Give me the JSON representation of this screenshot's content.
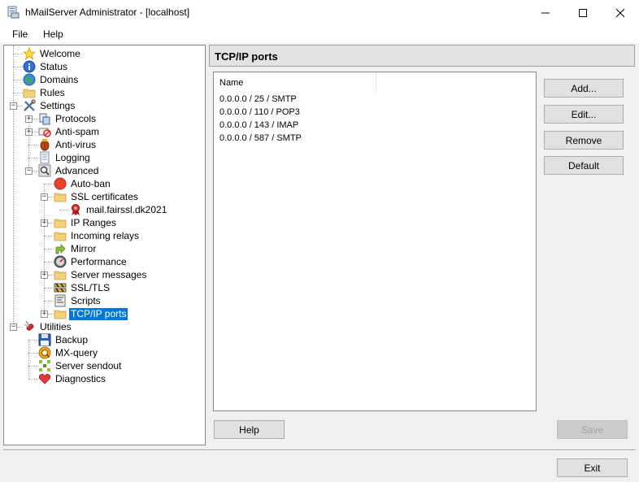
{
  "window": {
    "title": "hMailServer Administrator - [localhost]"
  },
  "menu": {
    "items": [
      {
        "label": "File"
      },
      {
        "label": "Help"
      }
    ]
  },
  "tree": {
    "items": [
      {
        "id": "welcome",
        "label": "Welcome",
        "icon": "star-icon",
        "depth": 1
      },
      {
        "id": "status",
        "label": "Status",
        "icon": "info-icon",
        "depth": 1
      },
      {
        "id": "domains",
        "label": "Domains",
        "icon": "globe-icon",
        "depth": 1
      },
      {
        "id": "rules",
        "label": "Rules",
        "icon": "folder-icon",
        "depth": 1
      },
      {
        "id": "settings",
        "label": "Settings",
        "icon": "tools-icon",
        "depth": 1,
        "expander": "-"
      },
      {
        "id": "protocols",
        "label": "Protocols",
        "icon": "protocols-icon",
        "depth": 2,
        "expander": "+"
      },
      {
        "id": "anti-spam",
        "label": "Anti-spam",
        "icon": "anti-spam-icon",
        "depth": 2,
        "expander": "+"
      },
      {
        "id": "anti-virus",
        "label": "Anti-virus",
        "icon": "bug-icon",
        "depth": 2
      },
      {
        "id": "logging",
        "label": "Logging",
        "icon": "document-icon",
        "depth": 2
      },
      {
        "id": "advanced",
        "label": "Advanced",
        "icon": "magnifier-icon",
        "depth": 2,
        "expander": "-"
      },
      {
        "id": "auto-ban",
        "label": "Auto-ban",
        "icon": "stop-icon",
        "depth": 3
      },
      {
        "id": "ssl-certificates",
        "label": "SSL certificates",
        "icon": "folder-icon",
        "depth": 3,
        "expander": "-"
      },
      {
        "id": "cert-mail",
        "label": "mail.fairssl.dk2021",
        "icon": "certificate-icon",
        "depth": 4
      },
      {
        "id": "ip-ranges",
        "label": "IP Ranges",
        "icon": "folder-icon",
        "depth": 3,
        "expander": "+"
      },
      {
        "id": "incoming-relays",
        "label": "Incoming relays",
        "icon": "folder-icon",
        "depth": 3
      },
      {
        "id": "mirror",
        "label": "Mirror",
        "icon": "mirror-arrow-icon",
        "depth": 3
      },
      {
        "id": "performance",
        "label": "Performance",
        "icon": "gauge-icon",
        "depth": 3
      },
      {
        "id": "server-messages",
        "label": "Server messages",
        "icon": "folder-icon",
        "depth": 3,
        "expander": "+"
      },
      {
        "id": "ssl-tls",
        "label": "SSL/TLS",
        "icon": "barrier-icon",
        "depth": 3
      },
      {
        "id": "scripts",
        "label": "Scripts",
        "icon": "script-icon",
        "depth": 3
      },
      {
        "id": "tcpip-ports",
        "label": "TCP/IP ports",
        "icon": "folder-icon",
        "depth": 3,
        "expander": "+",
        "selected": true
      },
      {
        "id": "utilities",
        "label": "Utilities",
        "icon": "swiss-knife-icon",
        "depth": 1,
        "expander": "-"
      },
      {
        "id": "backup",
        "label": "Backup",
        "icon": "floppy-icon",
        "depth": 2
      },
      {
        "id": "mx-query",
        "label": "MX-query",
        "icon": "mx-query-icon",
        "depth": 2
      },
      {
        "id": "server-sendout",
        "label": "Server sendout",
        "icon": "sendout-icon",
        "depth": 2
      },
      {
        "id": "diagnostics",
        "label": "Diagnostics",
        "icon": "heart-icon",
        "depth": 2
      }
    ]
  },
  "panel": {
    "title": "TCP/IP ports",
    "list": {
      "column": "Name",
      "rows": [
        "0.0.0.0 / 25 / SMTP",
        "0.0.0.0 / 110 / POP3",
        "0.0.0.0 / 143 / IMAP",
        "0.0.0.0 / 587 / SMTP"
      ]
    },
    "buttons": {
      "add": "Add...",
      "edit": "Edit...",
      "remove": "Remove",
      "default": "Default",
      "help": "Help",
      "save": "Save"
    }
  },
  "footer": {
    "exit": "Exit"
  },
  "colors": {
    "selection": "#0078d7",
    "window_bg": "#f0f0f0"
  }
}
